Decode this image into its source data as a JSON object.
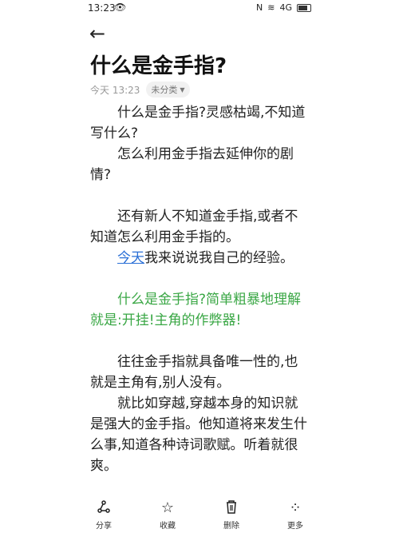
{
  "status_bar": {
    "time": "13:23",
    "signal": "4G"
  },
  "note": {
    "title": "什么是金手指?",
    "time": "今天 13:23",
    "category": "未分类",
    "paragraphs": [
      {
        "text": "什么是金手指?灵感枯竭,不知道写什么?"
      },
      {
        "text": "怎么利用金手指去延伸你的剧情?"
      },
      {
        "gap": true
      },
      {
        "text": "还有新人不知道金手指,或者不知道怎么利用金手指的。"
      },
      {
        "link": "今天",
        "rest": "我来说说我自己的经验。"
      },
      {
        "gap": true
      },
      {
        "text": "什么是金手指?简单粗暴地理解就是:开挂!主角的作弊器!",
        "green": true
      },
      {
        "gap": true
      },
      {
        "text": "往往金手指就具备唯一性的,也就是主角有,别人没有。"
      },
      {
        "text": "就比如穿越,穿越本身的知识就是强大的金手指。他知道将来发生什么事,知道各种诗词歌赋。听着就很爽。"
      }
    ]
  },
  "bottom_bar": {
    "share": "分享",
    "favorite": "收藏",
    "delete": "删除",
    "more": "更多"
  }
}
